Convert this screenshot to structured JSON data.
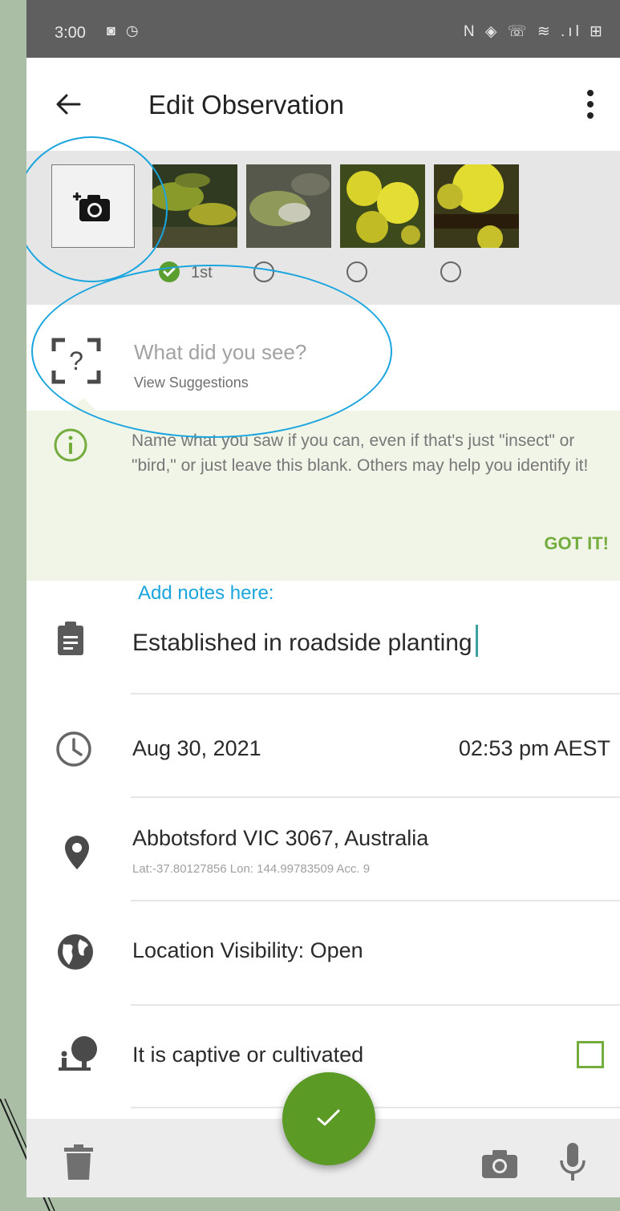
{
  "status_bar": {
    "time": "3:00",
    "left_icons": "◙ ◷",
    "right_icons": "N ◈ ☏ ≋ .ıl ⊞"
  },
  "header": {
    "title": "Edit Observation"
  },
  "photos": {
    "selected_label": "1st"
  },
  "species": {
    "placeholder": "What did you see?",
    "suggestions_label": "View Suggestions"
  },
  "tip": {
    "text": "Name what you saw if you can, even if that's just \"insect\" or \"bird,\" or just leave this blank. Others may help you identify it!",
    "dismiss_label": "GOT IT!"
  },
  "notes": {
    "hint": "Add notes here:",
    "value": "Established in roadside planting"
  },
  "datetime": {
    "date": "Aug 30, 2021",
    "time": "02:53 pm AEST"
  },
  "location": {
    "place": "Abbotsford VIC 3067, Australia",
    "coords": "Lat:-37.80127856 Lon: 144.99783509 Acc. 9"
  },
  "visibility": {
    "label": "Location Visibility: Open"
  },
  "captive": {
    "label": "It is captive or cultivated",
    "checked": false
  },
  "colors": {
    "accent_green": "#5c9a26",
    "annotation_blue": "#1aa5df",
    "tip_background": "#f0f5e8"
  },
  "icons": {
    "back": "arrow-left-icon",
    "more": "more-vert-icon",
    "add_photo": "add-camera-icon",
    "species": "unknown-species-icon",
    "info": "info-icon",
    "notes": "clipboard-icon",
    "time": "clock-icon",
    "location": "map-pin-icon",
    "visibility": "globe-icon",
    "captive": "tree-icon",
    "save": "check-icon",
    "delete": "trash-icon",
    "camera": "camera-icon",
    "mic": "microphone-icon"
  }
}
